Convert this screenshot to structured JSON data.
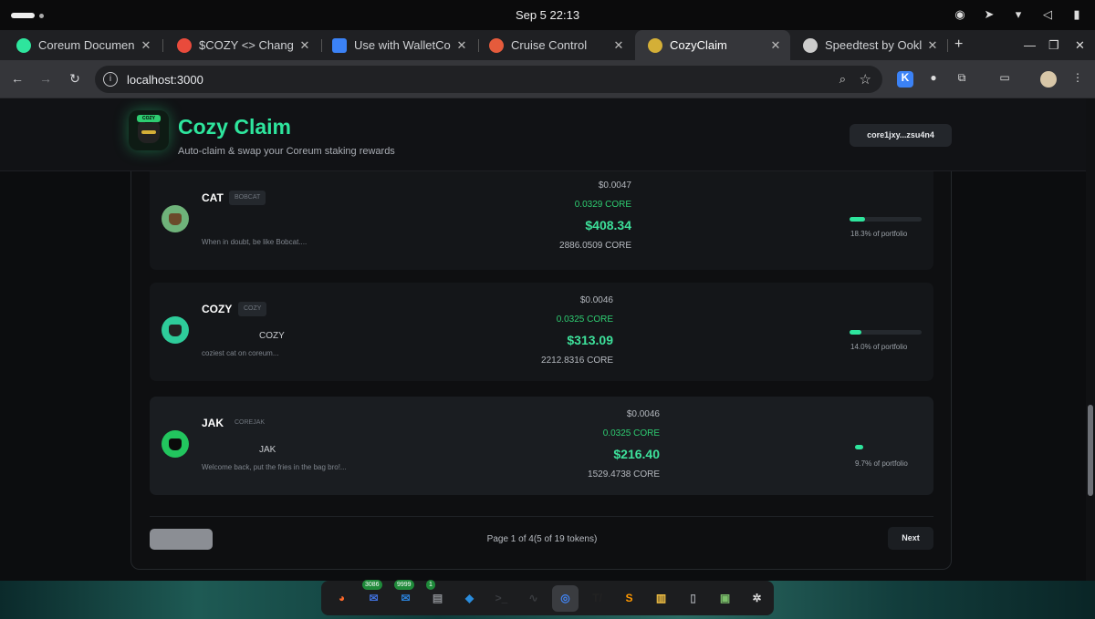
{
  "system": {
    "clock": "Sep 5  22:13"
  },
  "browser": {
    "tabs": [
      {
        "label": "Coreum Documen",
        "favicon_color": "#2ee59d"
      },
      {
        "label": "$COZY <> Change",
        "favicon_color": "#e94b3c"
      },
      {
        "label": "Use with WalletCo",
        "favicon_color": "#3b82f6"
      },
      {
        "label": "Cruise Control",
        "favicon_color": "#e55b3c"
      },
      {
        "label": "CozyClaim",
        "favicon_color": "#d4af37"
      },
      {
        "label": "Speedtest by Ookl",
        "favicon_color": "#cccccc"
      }
    ],
    "active_tab_index": 4,
    "url": "localhost:3000"
  },
  "app": {
    "title": "Cozy Claim",
    "subtitle": "Auto-claim & swap your Coreum staking rewards",
    "logo_text": "COZY",
    "wallet_address": "core1jxy...zsu4n4",
    "accent_color": "#2ee59d"
  },
  "tokens": [
    {
      "name": "CAT",
      "tag": "BOBCAT",
      "alias": "",
      "description": "When in doubt, be like Bobcat....",
      "price_usd": "$0.0047",
      "price_core": "0.0329 CORE",
      "value_usd": "$408.34",
      "balance": "2886.0509 CORE",
      "portfolio_pct": 18.3,
      "portfolio_label": "18.3% of portfolio",
      "avatar_color": "#6fb37a",
      "face_color": "#6b4a2a"
    },
    {
      "name": "COZY",
      "tag": "COZY",
      "alias": "COZY",
      "description": "coziest cat on coreum...",
      "price_usd": "$0.0046",
      "price_core": "0.0325 CORE",
      "value_usd": "$313.09",
      "balance": "2212.8316 CORE",
      "portfolio_pct": 14.0,
      "portfolio_label": "14.0% of portfolio",
      "avatar_color": "#2ecc9a",
      "face_color": "#222222"
    },
    {
      "name": "JAK",
      "tag": "COREJAK",
      "alias": "JAK",
      "description": "Welcome back, put the fries in the bag bro!...",
      "price_usd": "$0.0046",
      "price_core": "0.0325 CORE",
      "value_usd": "$216.40",
      "balance": "1529.4738 CORE",
      "portfolio_pct": 9.7,
      "portfolio_label": "9.7% of portfolio",
      "avatar_color": "#22c55e",
      "face_color": "#0b0b0b"
    }
  ],
  "pagination": {
    "info": "Page 1 of 4(5 of 19 tokens)",
    "next_label": "Next",
    "previous_label": ""
  },
  "dock": {
    "items": [
      {
        "icon": "firefox-icon",
        "color": "#ff6a2b"
      },
      {
        "icon": "email-client-icon",
        "color": "#3f6fd8",
        "badge": "3086"
      },
      {
        "icon": "thunderbird-icon",
        "color": "#2a7fd4",
        "badge": "9999"
      },
      {
        "icon": "files-icon",
        "color": "#8a8d92",
        "badge": "1"
      },
      {
        "icon": "vscode-icon",
        "color": "#2a8cdc"
      },
      {
        "icon": "terminal-icon",
        "color": "#3a3c40"
      },
      {
        "icon": "system-monitor-icon",
        "color": "#3a3c40"
      },
      {
        "icon": "chrome-icon",
        "color": "#4285f4"
      },
      {
        "icon": "typora-icon",
        "color": "#222222"
      },
      {
        "icon": "sublime-icon",
        "color": "#ff9800"
      },
      {
        "icon": "notes-icon",
        "color": "#f5c242"
      },
      {
        "icon": "usb-creator-icon",
        "color": "#9a9da2"
      },
      {
        "icon": "archive-icon",
        "color": "#7bbf6a"
      },
      {
        "icon": "settings-icon",
        "color": "#dddddd"
      }
    ]
  }
}
